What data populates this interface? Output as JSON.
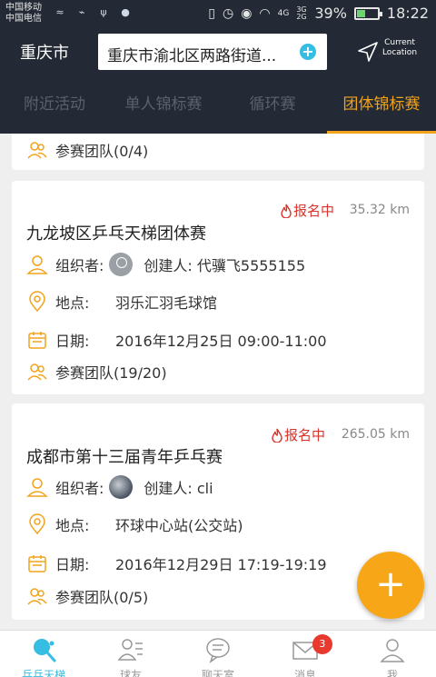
{
  "statusbar": {
    "carrier1": "中国移动",
    "carrier2": "中国电信",
    "network1": "4G",
    "network2": "3G 2G",
    "battery_percent": "39%",
    "battery_level": 0.39,
    "time": "18:22"
  },
  "header": {
    "city": "重庆市",
    "address": "重庆市渝北区两路街道...",
    "current_location_line1": "Current",
    "current_location_line2": "Location"
  },
  "tabs": [
    {
      "label": "附近活动",
      "active": false
    },
    {
      "label": "单人锦标赛",
      "active": false
    },
    {
      "label": "循环赛",
      "active": false
    },
    {
      "label": "团体锦标赛",
      "active": true
    }
  ],
  "cards": [
    {
      "teams": "参赛团队(0/4)"
    },
    {
      "status": "报名中",
      "distance": "35.32 km",
      "title": "九龙坡区乒乓天梯团体赛",
      "organizer_label": "组织者:",
      "creator": "创建人: 代骥飞5555155",
      "place_label": "地点:",
      "place": "羽乐汇羽毛球馆",
      "date_label": "日期:",
      "date": "2016年12月25日 09:00-11:00",
      "teams": "参赛团队(19/20)"
    },
    {
      "status": "报名中",
      "distance": "265.05 km",
      "title": "成都市第十三届青年乒乓赛",
      "organizer_label": "组织者:",
      "creator": "创建人: cli",
      "place_label": "地点:",
      "place": "环球中心站(公交站)",
      "date_label": "日期:",
      "date": "2016年12月29日 17:19-19:19",
      "teams": "参赛团队(0/5)"
    }
  ],
  "fab": {
    "label": "+"
  },
  "bottomnav": [
    {
      "label": "乒乓天梯",
      "icon": "pingpong-icon",
      "active": true
    },
    {
      "label": "球友",
      "icon": "friends-icon",
      "active": false
    },
    {
      "label": "聊天室",
      "icon": "chat-icon",
      "active": false
    },
    {
      "label": "消息",
      "icon": "mail-icon",
      "active": false,
      "badge": "3"
    },
    {
      "label": "我",
      "icon": "person-icon",
      "active": false
    }
  ],
  "colors": {
    "accent": "#f2a31b",
    "header_bg": "#232a35",
    "status_red": "#d9332b",
    "nav_active": "#35bde2"
  }
}
